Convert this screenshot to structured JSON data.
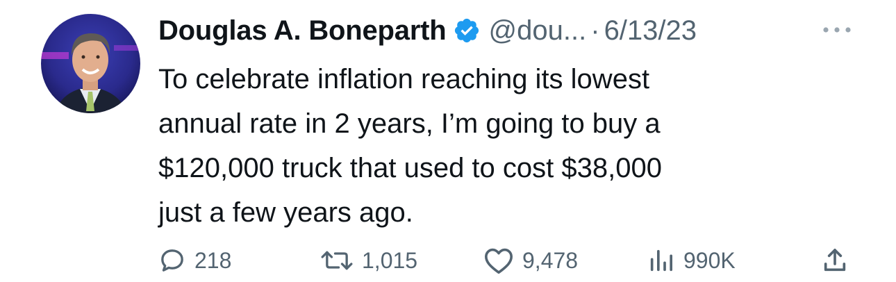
{
  "tweet": {
    "author_name": "Douglas A. Boneparth",
    "handle": "@dou...",
    "separator": "·",
    "date": "6/13/23",
    "text": "To celebrate inflation reaching its lowest\nannual rate in 2 years, I’m going to buy a\n$120,000 truck that used to cost $38,000\njust a few years ago."
  },
  "actions": {
    "replies": "218",
    "reposts": "1,015",
    "likes": "9,478",
    "views": "990K"
  },
  "icons": {
    "verified": "verified-badge-icon",
    "more": "more-options-icon",
    "reply": "reply-icon",
    "repost": "repost-icon",
    "like": "heart-icon",
    "views": "views-chart-icon",
    "share": "share-icon"
  },
  "colors": {
    "verified_blue": "#1d9bf0",
    "muted_text": "#536471",
    "primary_text": "#0f1419"
  }
}
